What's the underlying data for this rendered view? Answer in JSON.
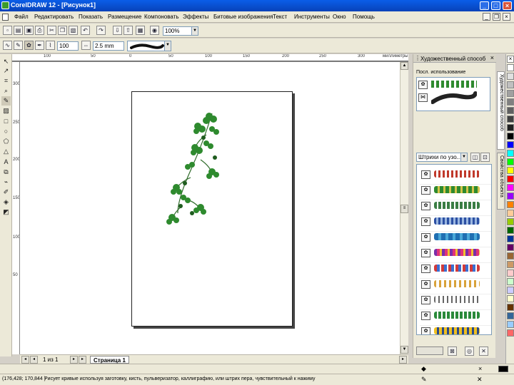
{
  "window": {
    "title": "CorelDRAW 12 - [Рисунок1]"
  },
  "menu": {
    "items": [
      "Файл",
      "Редактировать",
      "Показать",
      "Размещение",
      "Компоновать",
      "Эффекты",
      "Битовые изображения",
      "Текст",
      "Инструменты",
      "Окно",
      "Помощь"
    ]
  },
  "toolbar": {
    "zoom_value": "100%"
  },
  "property_bar": {
    "smoothing_value": "100",
    "width_value": "2.5 mm"
  },
  "ruler": {
    "top_labels": [
      "100",
      "50",
      "0",
      "50",
      "100",
      "150",
      "200",
      "250",
      "300"
    ],
    "units": "миллиметры",
    "left_labels": [
      "300",
      "250",
      "200",
      "150",
      "100",
      "50"
    ]
  },
  "page_nav": {
    "counter": "1 из 1",
    "tab": "Страница 1"
  },
  "docker": {
    "title": "Художественный способ",
    "recent_label": "Посл. использование",
    "category_value": "Штрихи по узо...",
    "side_tabs": [
      "Художественный способ",
      "Свойства объекта"
    ]
  },
  "status": {
    "coords": "(176,428; 170,844 )",
    "hint": "Рисует кривые используя заготовку, кисть, пульверизатор, каллиграфию, или штрих пера, чувствительный к нажиму"
  },
  "palette_colors": [
    "#ffffff",
    "#e0e0e0",
    "#c0c0c0",
    "#a0a0a0",
    "#808080",
    "#606060",
    "#404040",
    "#202020",
    "#000000",
    "#0000ff",
    "#00ffff",
    "#00ff00",
    "#ffff00",
    "#ff0000",
    "#ff00ff",
    "#9a00ff",
    "#ff8000",
    "#ffcc99",
    "#99cc00",
    "#006600",
    "#003399",
    "#660066",
    "#996633",
    "#cc9966",
    "#ffcccc",
    "#ccffcc",
    "#ccccff",
    "#ffffcc",
    "#663300",
    "#336699",
    "#99ccff",
    "#ff6666"
  ]
}
